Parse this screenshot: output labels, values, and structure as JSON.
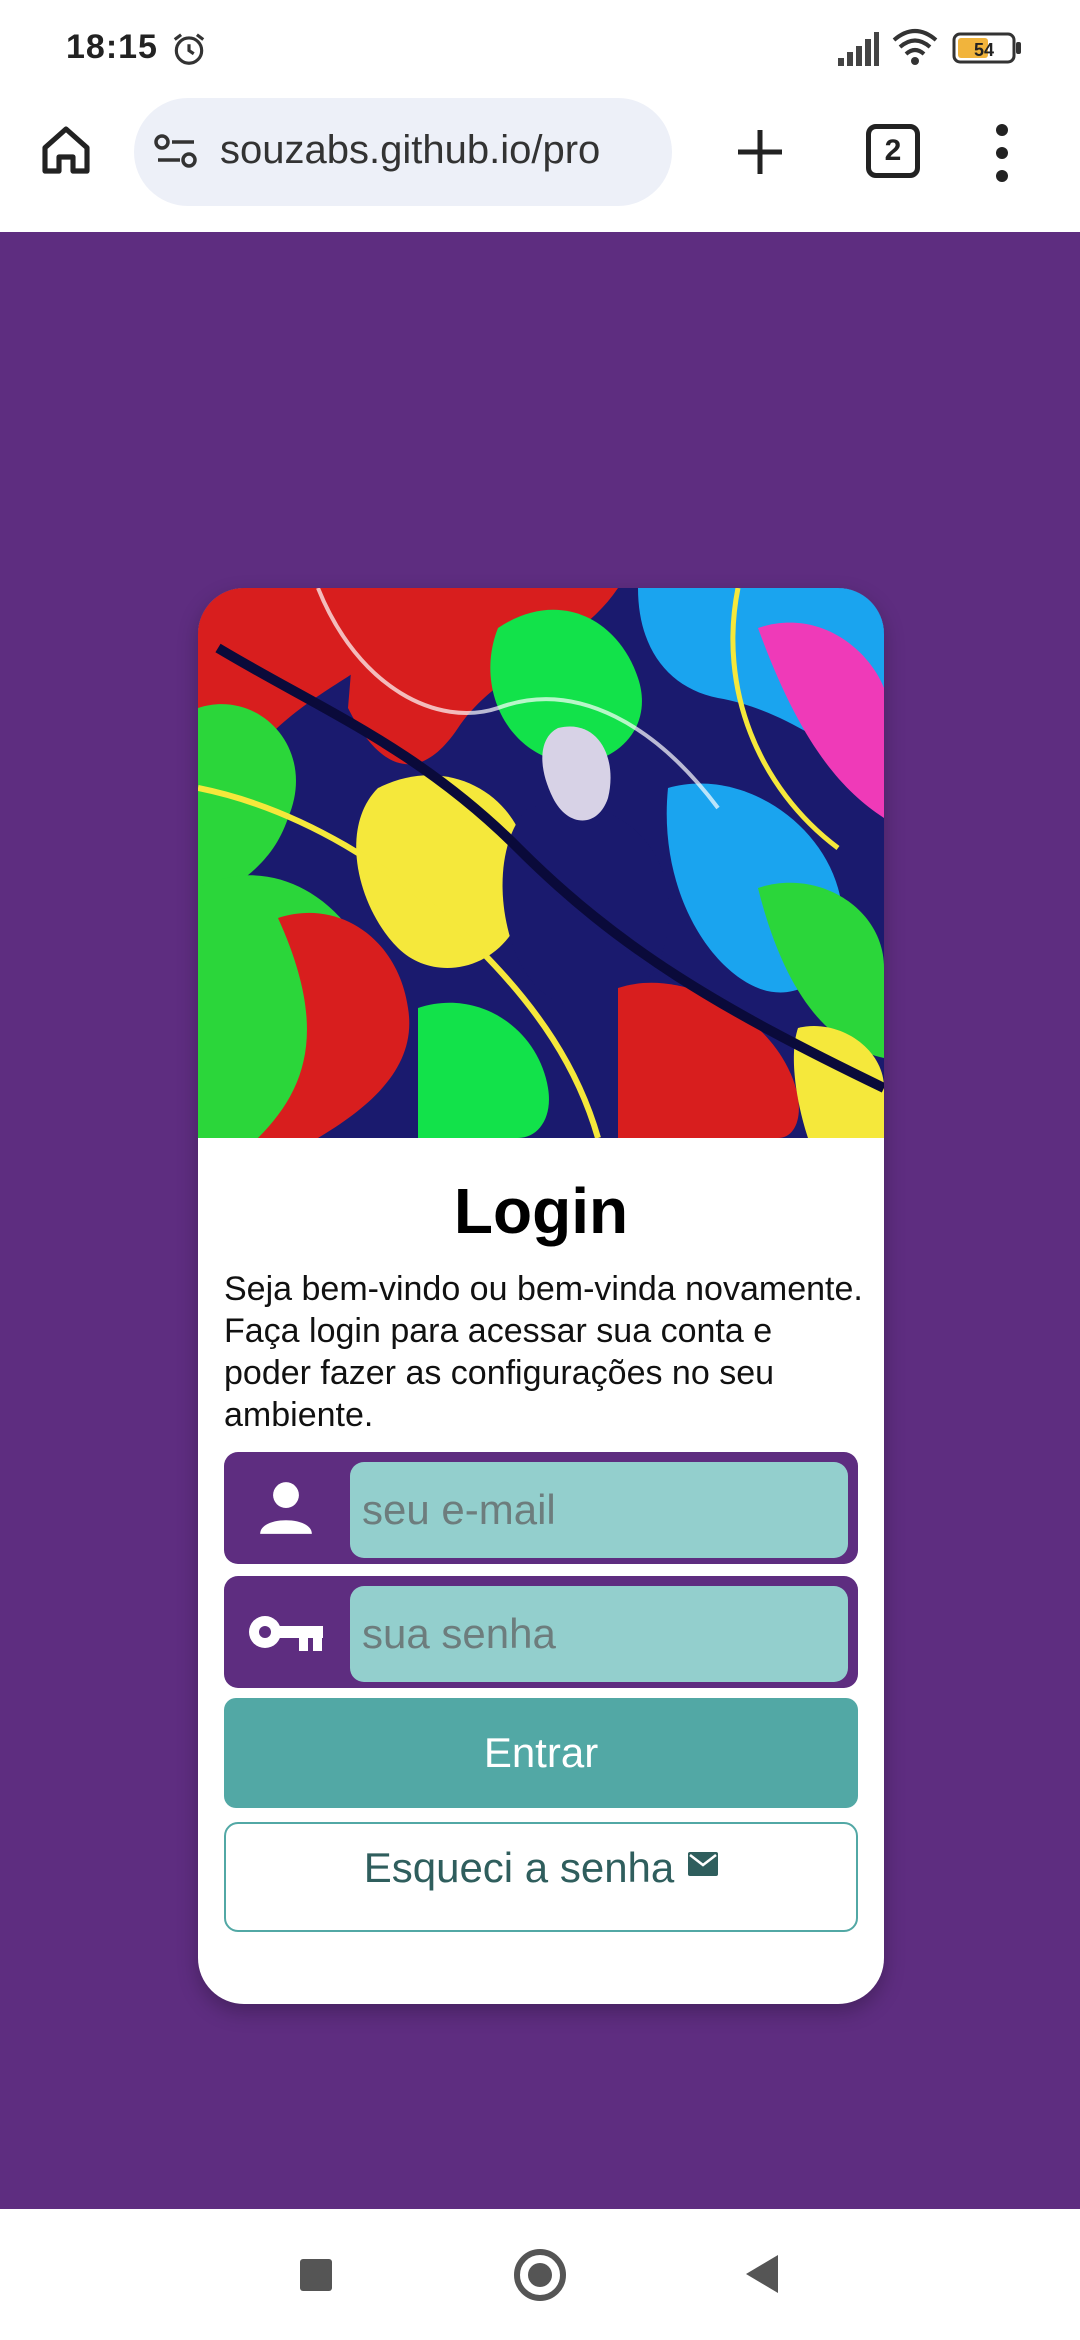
{
  "status_bar": {
    "time": "18:15",
    "battery_level": "54",
    "icons": [
      "alarm-icon",
      "signal-icon",
      "wifi-icon",
      "battery-icon"
    ]
  },
  "browser": {
    "url": "souzabs.github.io/pro",
    "tab_count": "2",
    "icons": [
      "home-icon",
      "site-settings-icon",
      "plus-icon",
      "tabs-icon",
      "more-vert-icon"
    ]
  },
  "login": {
    "title": "Login",
    "description": "Seja bem-vindo ou bem-vinda novamente. Faça login para acessar sua conta e poder fazer as configurações no seu ambiente.",
    "email_placeholder": "seu e-mail",
    "email_value": "",
    "password_placeholder": "sua senha",
    "password_value": "",
    "enter_label": "Entrar",
    "forgot_label": "Esqueci a senha"
  },
  "colors": {
    "page_background": "#5e2d80",
    "field_background": "#93cfcd",
    "button_primary": "#52a8a5",
    "forgot_text": "#2f5e5d"
  },
  "nav": {
    "icons": [
      "recent-apps-icon",
      "home-circle-icon",
      "back-triangle-icon"
    ]
  }
}
